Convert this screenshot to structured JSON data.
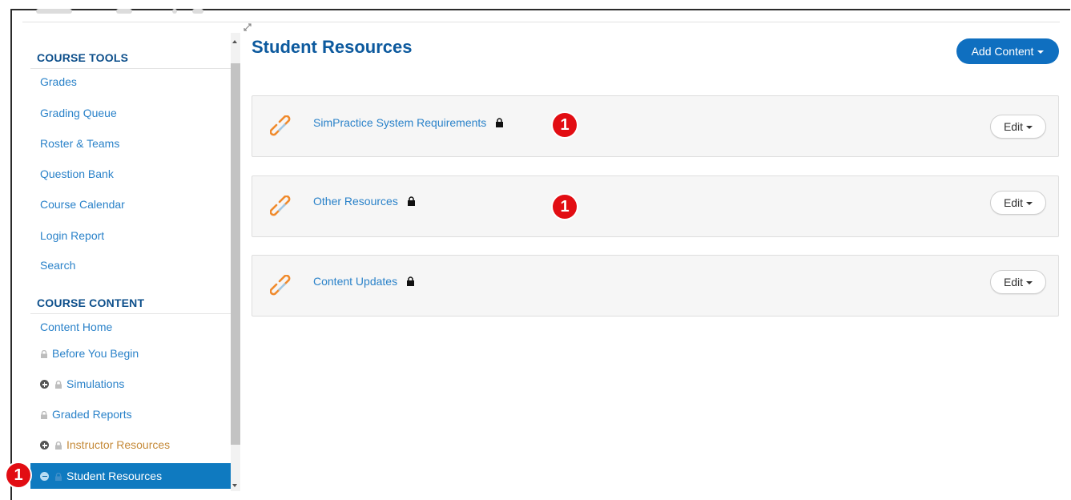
{
  "sidebar": {
    "course_tools_heading": "COURSE TOOLS",
    "tools": [
      {
        "label": "Grades"
      },
      {
        "label": "Grading Queue"
      },
      {
        "label": "Roster & Teams"
      },
      {
        "label": "Question Bank"
      },
      {
        "label": "Course Calendar"
      },
      {
        "label": "Login Report"
      },
      {
        "label": "Search"
      }
    ],
    "course_content_heading": "COURSE CONTENT",
    "content_home": "Content Home",
    "content": [
      {
        "label": "Before You Begin",
        "locked": true
      },
      {
        "label": "Simulations",
        "locked": true,
        "expand": "plus"
      },
      {
        "label": "Graded Reports",
        "locked": true
      },
      {
        "label": "Instructor Resources",
        "locked": true,
        "expand": "plus"
      },
      {
        "label": "Student Resources",
        "locked": true,
        "expand": "minus",
        "selected": true
      }
    ]
  },
  "main": {
    "title": "Student Resources",
    "add_content_label": "Add Content",
    "items": [
      {
        "title": "SimPractice System Requirements",
        "edit_label": "Edit",
        "icon": "link-icon",
        "locked": true
      },
      {
        "title": "Other Resources",
        "edit_label": "Edit",
        "icon": "link-icon",
        "locked": true
      },
      {
        "title": "Content Updates",
        "edit_label": "Edit",
        "icon": "link-icon",
        "locked": true
      }
    ]
  },
  "annotations": {
    "callout_1": "1",
    "callout_2": "1",
    "callout_3": "1"
  },
  "colors": {
    "accent": "#0f7ac0",
    "link": "#2a82c9",
    "heading": "#0d4f8b",
    "instructor_link": "#c58a39",
    "callout": "#e20d13",
    "link_icon": "#f08a2c"
  }
}
